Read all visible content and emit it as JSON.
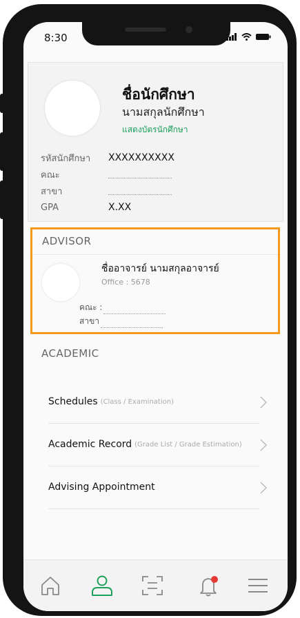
{
  "status_bar": {
    "time": "8:30"
  },
  "profile": {
    "name": "ชื่อนักศึกษา",
    "surname": "นามสกุลนักศึกษา",
    "show_card_link": "แสดงบัตรนักศึกษา",
    "fields": [
      {
        "label": "รหัสนักศึกษา",
        "value": "XXXXXXXXXX"
      },
      {
        "label": "คณะ",
        "value": ""
      },
      {
        "label": "สาขา",
        "value": ""
      },
      {
        "label": "GPA",
        "value": "X.XX"
      }
    ]
  },
  "advisor": {
    "section_title": "ADVISOR",
    "name": "ชื่ออาจารย์  นามสกุลอาจารย์",
    "office": "Office : 5678",
    "faculty_label": "คณะ :",
    "major_label": "สาขา"
  },
  "academic": {
    "section_title": "ACADEMIC",
    "items": [
      {
        "label": "Schedules",
        "sub": "(Class / Examination)"
      },
      {
        "label": "Academic Record",
        "sub": "(Grade List / Grade Estimation)"
      },
      {
        "label": "Advising Appointment",
        "sub": ""
      }
    ]
  },
  "tabbar": {
    "icons": [
      "home-icon",
      "profile-icon",
      "scan-icon",
      "notification-bell-icon",
      "menu-icon"
    ],
    "active_color": "#1aa05a",
    "badge_color": "#e53935"
  },
  "colors": {
    "highlight_border": "#f39a1d",
    "link_green": "#1aa05a"
  }
}
